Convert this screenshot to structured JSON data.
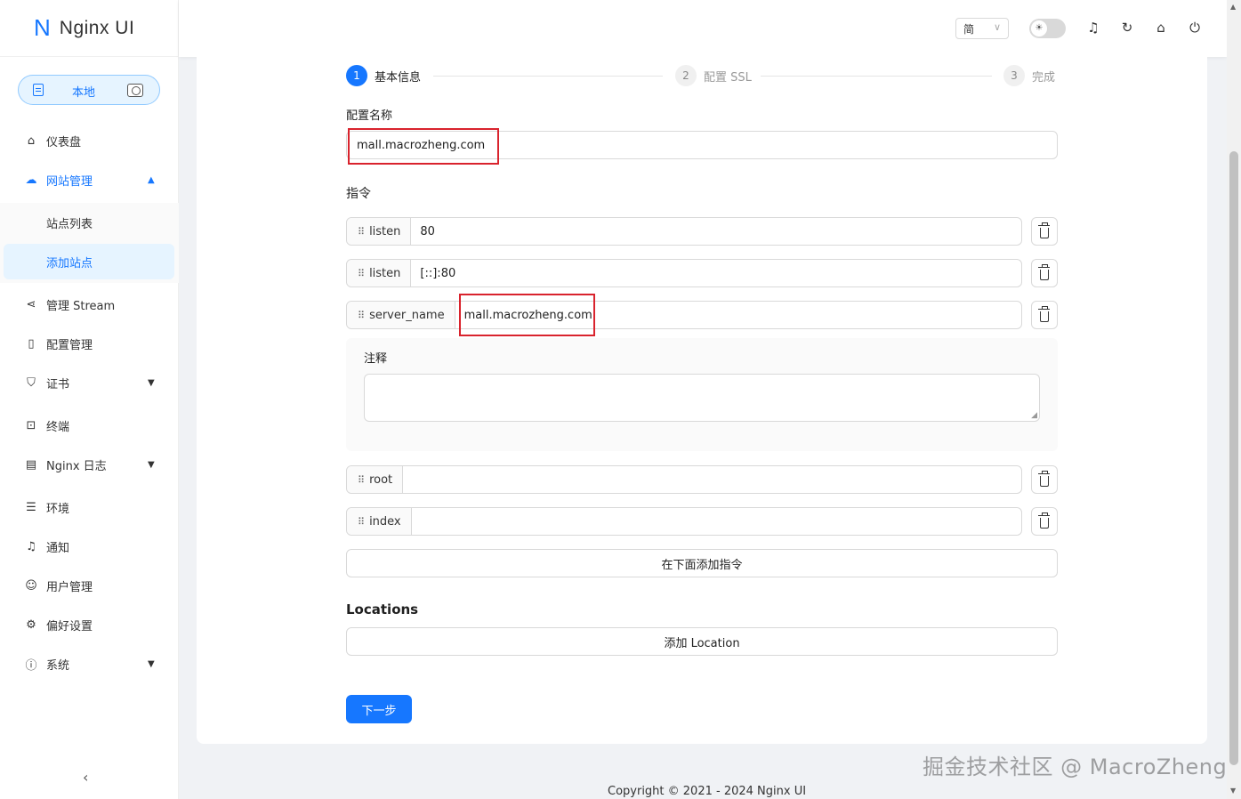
{
  "app": {
    "logo_letter": "N",
    "name": "Nginx UI"
  },
  "environment": {
    "label": "本地"
  },
  "sidebar": {
    "items": [
      {
        "label": "仪表盘",
        "icon": "home-icon"
      },
      {
        "label": "网站管理",
        "icon": "cloud-icon",
        "expanded": true
      },
      {
        "label": "管理 Stream",
        "icon": "share-icon"
      },
      {
        "label": "配置管理",
        "icon": "file-icon"
      },
      {
        "label": "证书",
        "icon": "shield-icon"
      },
      {
        "label": "终端",
        "icon": "terminal-icon"
      },
      {
        "label": "Nginx 日志",
        "icon": "file-text-icon"
      },
      {
        "label": "环境",
        "icon": "database-icon"
      },
      {
        "label": "通知",
        "icon": "bell-icon"
      },
      {
        "label": "用户管理",
        "icon": "user-icon"
      },
      {
        "label": "偏好设置",
        "icon": "gear-icon"
      },
      {
        "label": "系统",
        "icon": "info-icon"
      }
    ],
    "subitems": [
      {
        "label": "站点列表"
      },
      {
        "label": "添加站点",
        "selected": true
      }
    ]
  },
  "header": {
    "language": "简"
  },
  "steps": [
    {
      "num": "1",
      "title": "基本信息",
      "status": "active"
    },
    {
      "num": "2",
      "title": "配置 SSL",
      "status": "wait"
    },
    {
      "num": "3",
      "title": "完成",
      "status": "wait"
    }
  ],
  "form": {
    "config_name_label": "配置名称",
    "config_name_value": "mall.macrozheng.com",
    "directives_label": "指令",
    "directives": [
      {
        "name": "listen",
        "value": "80"
      },
      {
        "name": "listen",
        "value": "[::]:80"
      },
      {
        "name": "server_name",
        "value": "mall.macrozheng.com"
      },
      {
        "name": "root",
        "value": ""
      },
      {
        "name": "index",
        "value": ""
      }
    ],
    "comment_label": "注释",
    "add_directive_button": "在下面添加指令",
    "locations_title": "Locations",
    "add_location_button": "添加 Location",
    "next_button": "下一步"
  },
  "footer": {
    "copyright": "Copyright © 2021 - 2024 Nginx UI"
  },
  "watermark": {
    "text": "掘金技术社区 @ MacroZheng"
  },
  "colors": {
    "primary": "#1677ff",
    "highlight": "#d9232d"
  }
}
